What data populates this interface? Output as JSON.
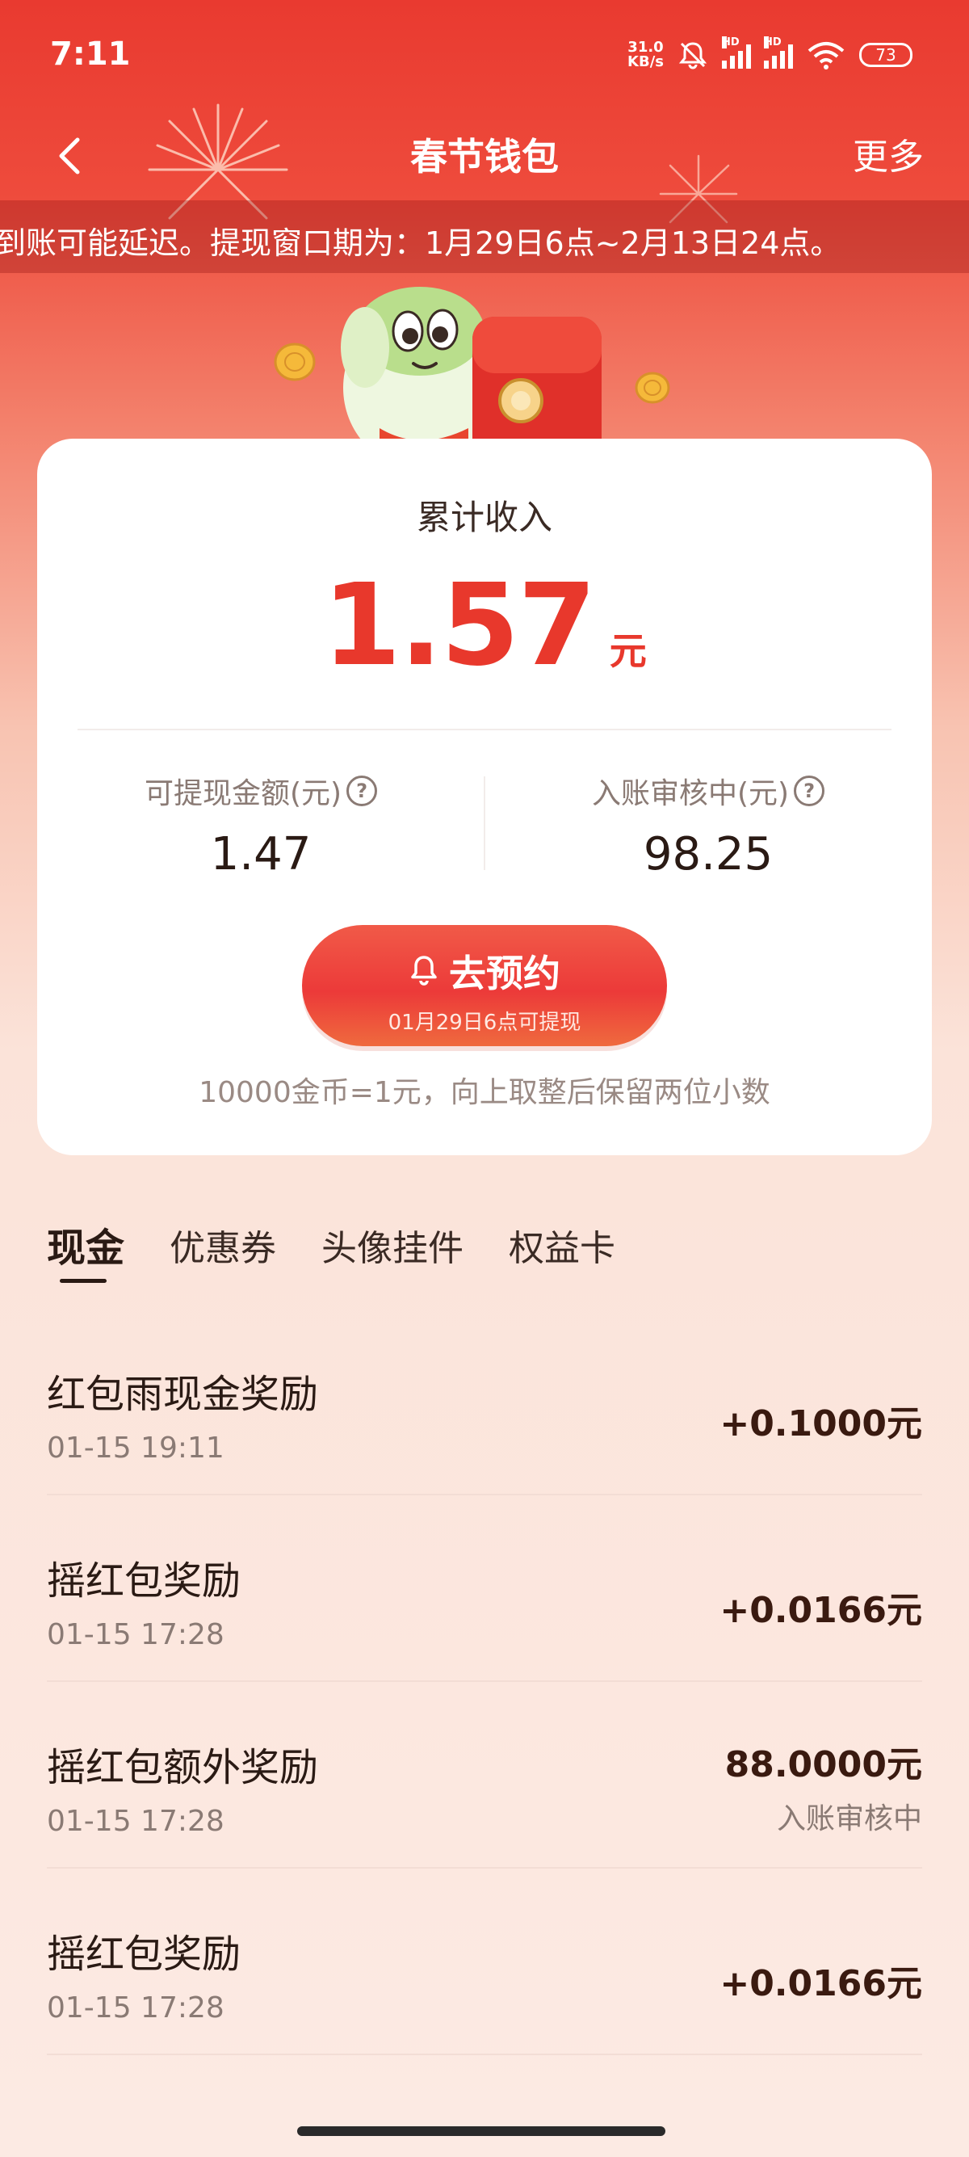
{
  "status_bar": {
    "time": "7:11",
    "net_speed_value": "31.0",
    "net_speed_unit": "KB/s",
    "hd_label": "HD",
    "battery": "73"
  },
  "nav": {
    "title": "春节钱包",
    "more_label": "更多"
  },
  "notice": {
    "text": "到账可能延迟。提现窗口期为：1月29日6点~2月13日24点。"
  },
  "summary": {
    "label": "累计收入",
    "amount": "1.57",
    "unit": "元",
    "withdrawable_label": "可提现金额(元)",
    "withdrawable_value": "1.47",
    "pending_label": "入账审核中(元)",
    "pending_value": "98.25",
    "help_glyph": "?",
    "reserve_button_label": "去预约",
    "reserve_button_sub": "01月29日6点可提现",
    "rate_note": "10000金币=1元，向上取整后保留两位小数"
  },
  "tabs": [
    {
      "label": "现金",
      "active": true
    },
    {
      "label": "优惠券",
      "active": false
    },
    {
      "label": "头像挂件",
      "active": false
    },
    {
      "label": "权益卡",
      "active": false
    }
  ],
  "transactions": [
    {
      "title": "红包雨现金奖励",
      "time": "01-15 19:11",
      "amount": "+0.1000元",
      "status": ""
    },
    {
      "title": "摇红包奖励",
      "time": "01-15 17:28",
      "amount": "+0.0166元",
      "status": ""
    },
    {
      "title": "摇红包额外奖励",
      "time": "01-15 17:28",
      "amount": "88.0000元",
      "status": "入账审核中"
    },
    {
      "title": "摇红包奖励",
      "time": "01-15 17:28",
      "amount": "+0.0166元",
      "status": ""
    }
  ],
  "icons": {
    "back": "chevron-left-icon",
    "bell": "bell-icon",
    "help": "question-circle-icon",
    "wifi": "wifi-icon",
    "mute": "bell-off-icon"
  },
  "colors": {
    "header_red": "#e93a30",
    "amount_red": "#e8382c",
    "button_red": "#ec3a39",
    "text_dark": "#2a1a14"
  }
}
